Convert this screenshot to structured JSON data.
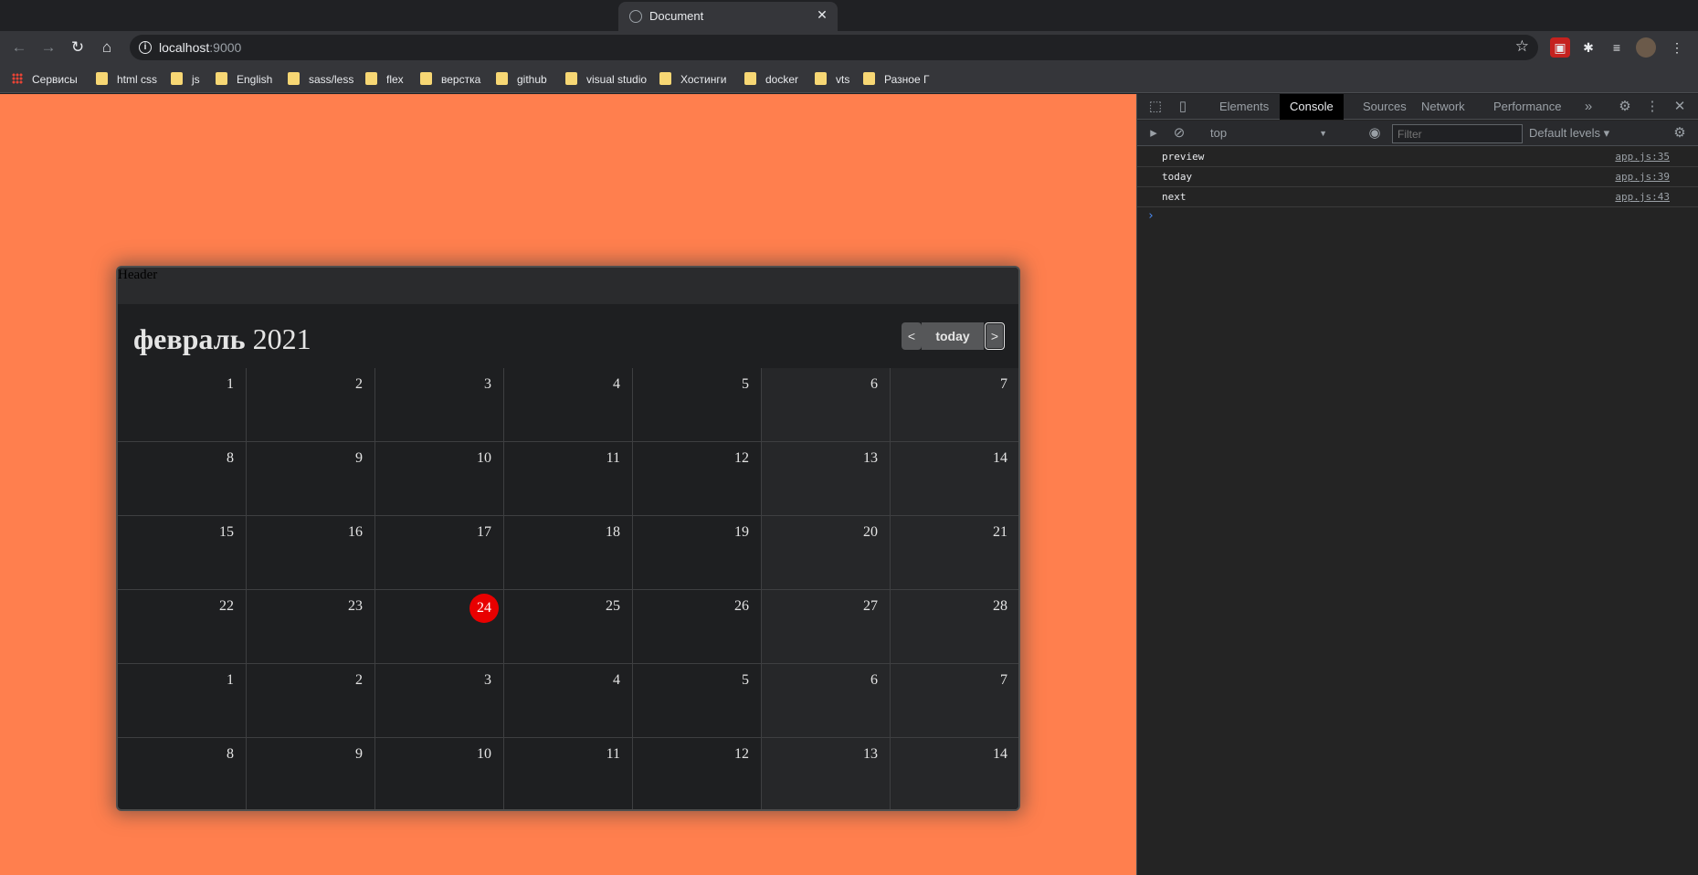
{
  "browser": {
    "tab": {
      "title": "Document",
      "close": "✕"
    },
    "nav": {
      "back": "←",
      "forward": "→",
      "reload": "↻",
      "home": "⌂"
    },
    "address": {
      "host": "localhost",
      "port": ":9000"
    },
    "bookmarks": [
      {
        "label": "Сервисы",
        "icon": "apps-icon"
      },
      {
        "label": "html css",
        "icon": "folder-icon"
      },
      {
        "label": "js",
        "icon": "folder-icon"
      },
      {
        "label": "English",
        "icon": "folder-icon"
      },
      {
        "label": "sass/less",
        "icon": "folder-icon"
      },
      {
        "label": "flex",
        "icon": "folder-icon"
      },
      {
        "label": "верстка",
        "icon": "folder-icon"
      },
      {
        "label": "github",
        "icon": "folder-icon"
      },
      {
        "label": "visual studio",
        "icon": "folder-icon"
      },
      {
        "label": "Хостинги",
        "icon": "folder-icon"
      },
      {
        "label": "docker",
        "icon": "folder-icon"
      },
      {
        "label": "vts",
        "icon": "folder-icon"
      },
      {
        "label": "Разное Г",
        "icon": "folder-icon"
      }
    ]
  },
  "page": {
    "background": "#ff7f4e",
    "header_text": "Header",
    "calendar": {
      "month": "февраль",
      "year": "2021",
      "prev_label": "<",
      "today_label": "today",
      "next_label": ">",
      "today_color": "#e80000",
      "weeks": [
        [
          "1",
          "2",
          "3",
          "4",
          "5",
          "6",
          "7"
        ],
        [
          "8",
          "9",
          "10",
          "11",
          "12",
          "13",
          "14"
        ],
        [
          "15",
          "16",
          "17",
          "18",
          "19",
          "20",
          "21"
        ],
        [
          "22",
          "23",
          "24",
          "25",
          "26",
          "27",
          "28"
        ],
        [
          "1",
          "2",
          "3",
          "4",
          "5",
          "6",
          "7"
        ],
        [
          "8",
          "9",
          "10",
          "11",
          "12",
          "13",
          "14"
        ]
      ],
      "current_day": "24"
    }
  },
  "devtools": {
    "tabs": [
      "Elements",
      "Console",
      "Sources",
      "Network",
      "Performance"
    ],
    "active_tab": "Console",
    "more": "»",
    "context": "top",
    "filter_placeholder": "Filter",
    "levels": "Default levels ▾",
    "logs": [
      {
        "message": "preview",
        "source": "app.js:35"
      },
      {
        "message": "today",
        "source": "app.js:39"
      },
      {
        "message": "next",
        "source": "app.js:43"
      }
    ],
    "prompt": "›"
  }
}
